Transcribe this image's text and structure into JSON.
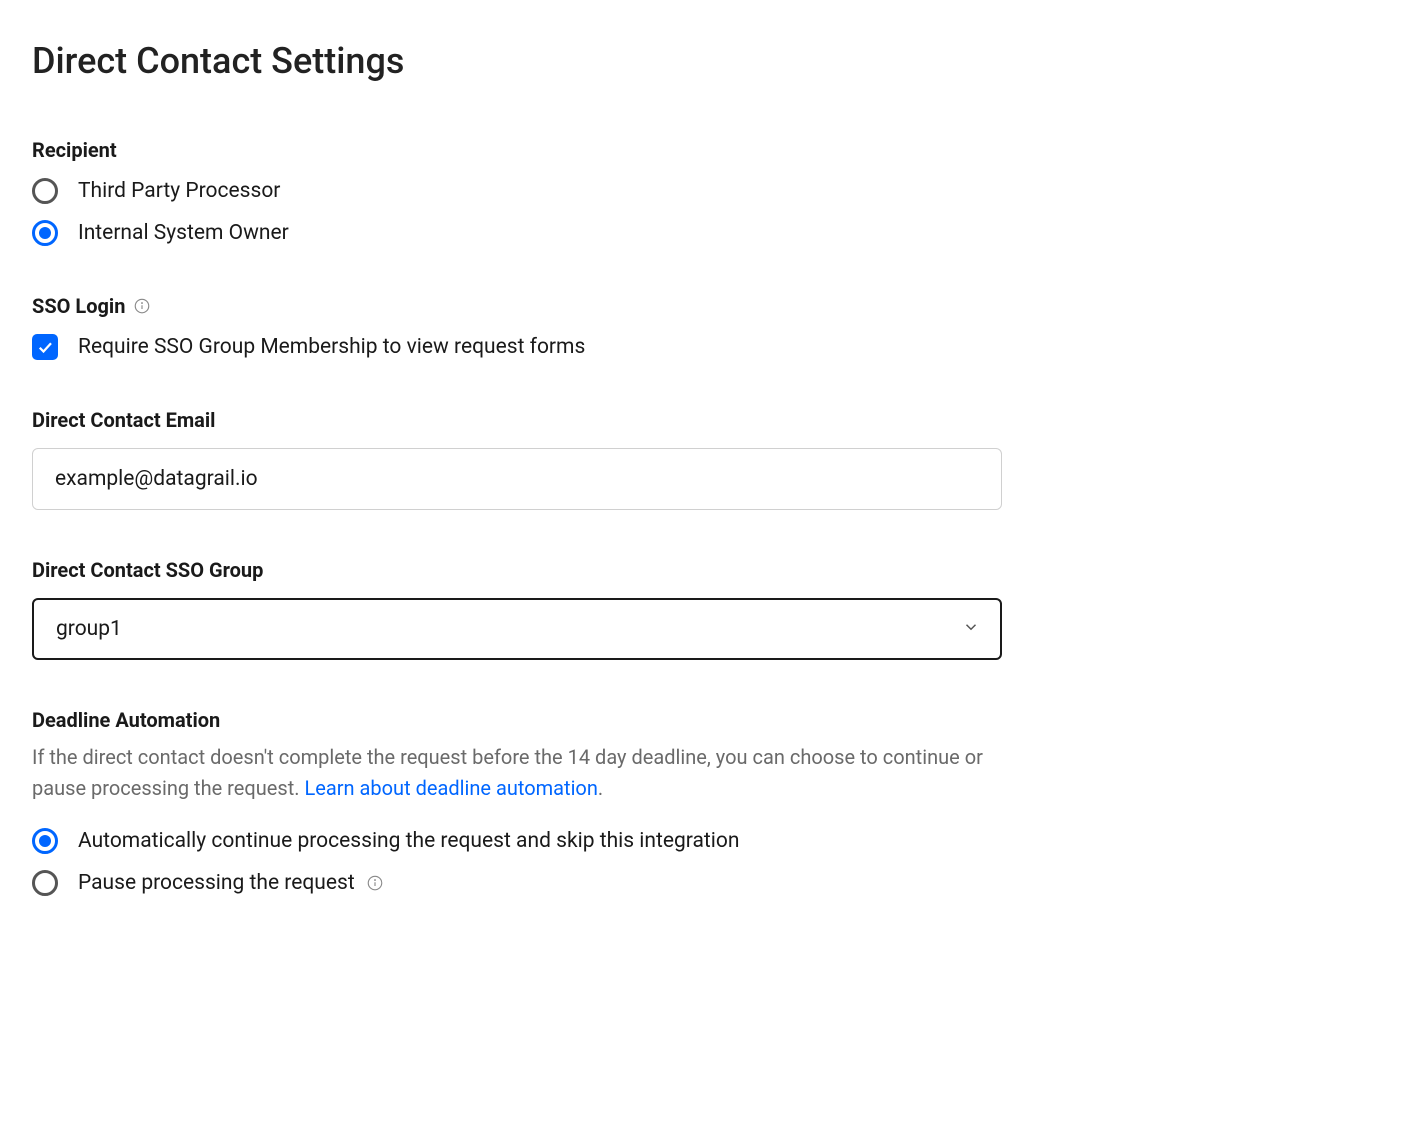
{
  "title": "Direct Contact Settings",
  "recipient": {
    "label": "Recipient",
    "options": [
      {
        "label": "Third Party Processor",
        "checked": false
      },
      {
        "label": "Internal System Owner",
        "checked": true
      }
    ]
  },
  "sso": {
    "label": "SSO Login",
    "checkbox_label": "Require SSO Group Membership to view request forms",
    "checked": true
  },
  "email": {
    "label": "Direct Contact Email",
    "value": "example@datagrail.io"
  },
  "sso_group": {
    "label": "Direct Contact SSO Group",
    "value": "group1"
  },
  "deadline": {
    "label": "Deadline Automation",
    "help_text_1": "If the direct contact doesn't complete the request before the 14 day deadline, you can choose to continue or pause processing the request. ",
    "help_link": "Learn about deadline automation",
    "help_period": ".",
    "options": [
      {
        "label": "Automatically continue processing the request and skip this integration",
        "checked": true
      },
      {
        "label": "Pause processing the request",
        "checked": false,
        "has_info": true
      }
    ]
  }
}
